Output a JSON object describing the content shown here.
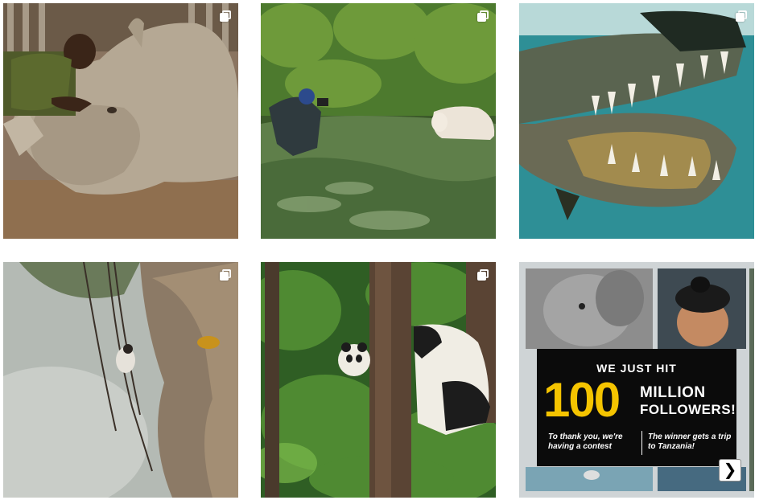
{
  "feed": {
    "posts": [
      {
        "subject": "rhino-and-keeper",
        "type": "carousel"
      },
      {
        "subject": "photographer-and-spirit-bear",
        "type": "carousel"
      },
      {
        "subject": "crocodile-underwater",
        "type": "carousel"
      },
      {
        "subject": "cliff-honey-hunter",
        "type": "carousel"
      },
      {
        "subject": "panda-in-forest",
        "type": "carousel"
      },
      {
        "subject": "followers-milestone-promo",
        "type": "carousel"
      }
    ],
    "promo": {
      "headline": "WE JUST HIT",
      "number": "100",
      "word1": "MILLION",
      "word2": "FOLLOWERS!",
      "left_text": "To thank you, we're having a contest",
      "right_text": "The winner gets a trip to Tanzania!",
      "next_glyph": "❯"
    }
  },
  "colors": {
    "promo_accent": "#f5c400",
    "promo_box": "#0b0b0b"
  }
}
